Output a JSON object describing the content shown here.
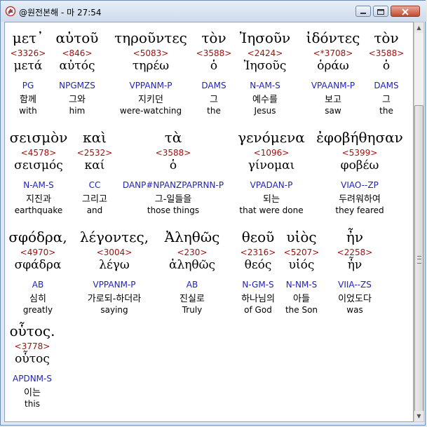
{
  "window": {
    "title": "@원전본해 - 마 27:54"
  },
  "words": [
    {
      "greek": "μετ᾽",
      "strong": "<3326>",
      "lemma": "μετά",
      "parse": "PG",
      "korean": "함께",
      "english": "with"
    },
    {
      "greek": "αὐτοῦ",
      "strong": "<846>",
      "lemma": "αὐτός",
      "parse": "NPGMZS",
      "korean": "그와",
      "english": "him"
    },
    {
      "greek": "τηροῦντες",
      "strong": "<5083>",
      "lemma": "τηρέω",
      "parse": "VPPANM-P",
      "korean": "지키던",
      "english": "were-watching"
    },
    {
      "greek": "τὸν",
      "strong": "<3588>",
      "lemma": "ὁ",
      "parse": "DAMS",
      "korean": "그",
      "english": "the"
    },
    {
      "greek": "Ἰησοῦν",
      "strong": "<2424>",
      "lemma": "Ἰησοῦς",
      "parse": "N-AM-S",
      "korean": "예수를",
      "english": "Jesus"
    },
    {
      "greek": "ἰδόντες",
      "strong": "<*3708>",
      "lemma": "ὁράω",
      "parse": "VPAANM-P",
      "korean": "보고",
      "english": "saw"
    },
    {
      "greek": "τὸν",
      "strong": "<3588>",
      "lemma": "ὁ",
      "parse": "DAMS",
      "korean": "그",
      "english": "the"
    },
    {
      "greek": "σεισμὸν",
      "strong": "<4578>",
      "lemma": "σεισμός",
      "parse": "N-AM-S",
      "korean": "지진과",
      "english": "earthquake"
    },
    {
      "greek": "καὶ",
      "strong": "<2532>",
      "lemma": "καί",
      "parse": "CC",
      "korean": "그리고",
      "english": "and"
    },
    {
      "greek": "τὰ",
      "strong": "<3588>",
      "lemma": "ὁ",
      "parse": "DANP#NPANZPAPRNN-P",
      "korean": "그-일들을",
      "english": "those things"
    },
    {
      "greek": "γενόμενα",
      "strong": "<1096>",
      "lemma": "γίνομαι",
      "parse": "VPADAN-P",
      "korean": "되는",
      "english": "that were done"
    },
    {
      "greek": "ἐφοβήθησαν",
      "strong": "<5399>",
      "lemma": "φοβέω",
      "parse": "VIAO--ZP",
      "korean": "두려워하여",
      "english": "they feared"
    },
    {
      "greek": "σφόδρα,",
      "strong": "<4970>",
      "lemma": "σφάδρα",
      "parse": "AB",
      "korean": "심히",
      "english": "greatly"
    },
    {
      "greek": "λέγοντες,",
      "strong": "<3004>",
      "lemma": "λέγω",
      "parse": "VPPANM-P",
      "korean": "가로되-하더라",
      "english": "saying"
    },
    {
      "greek": "Ἀληθῶς",
      "strong": "<230>",
      "lemma": "ἀληθῶς",
      "parse": "AB",
      "korean": "진실로",
      "english": "Truly"
    },
    {
      "greek": "θεοῦ",
      "strong": "<2316>",
      "lemma": "θεός",
      "parse": "N-GM-S",
      "korean": "하나님의",
      "english": "of God"
    },
    {
      "greek": "υἱὸς",
      "strong": "<5207>",
      "lemma": "υἱός",
      "parse": "N-NM-S",
      "korean": "아들",
      "english": "the Son"
    },
    {
      "greek": "ἦν",
      "strong": "<2258>",
      "lemma": "ἦν",
      "parse": "VIIA--ZS",
      "korean": "이었도다",
      "english": "was"
    },
    {
      "greek": "οὗτος.",
      "strong": "<3778>",
      "lemma": "οὗτος",
      "parse": "APDNM-S",
      "korean": "이는",
      "english": "this"
    }
  ]
}
